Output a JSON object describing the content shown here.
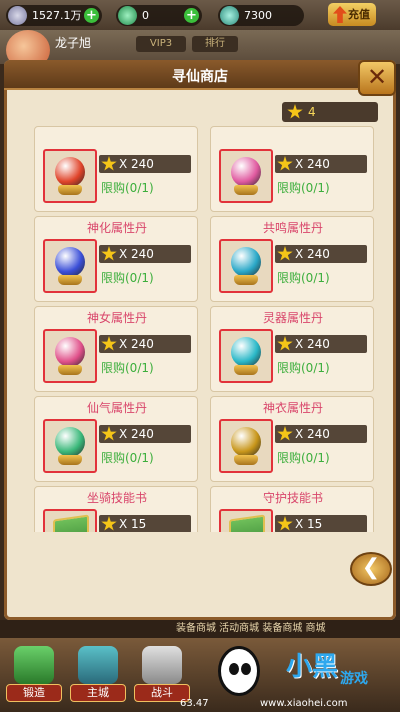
{
  "topbar": {
    "silver": "1527.1万",
    "jade": "0",
    "gold": "7300",
    "recharge_label": "充值"
  },
  "player": {
    "name": "龙子旭",
    "vip": "VIP3",
    "rank": "排行"
  },
  "shop": {
    "title": "寻仙商店",
    "currency": "4",
    "close_symbol": "✕",
    "items": [
      {
        "name": "",
        "price": "X 240",
        "limit": "限购(0/1)",
        "orb_color": "#e0442a"
      },
      {
        "name": "",
        "price": "X 240",
        "limit": "限购(0/1)",
        "orb_color": "#e05aa0"
      },
      {
        "name": "神化属性丹",
        "price": "X 240",
        "limit": "限购(0/1)",
        "orb_color": "#3b4fd8"
      },
      {
        "name": "共鸣属性丹",
        "price": "X 240",
        "limit": "限购(0/1)",
        "orb_color": "#2aa8c8"
      },
      {
        "name": "神女属性丹",
        "price": "X 240",
        "limit": "限购(0/1)",
        "orb_color": "#e0508a"
      },
      {
        "name": "灵器属性丹",
        "price": "X 240",
        "limit": "限购(0/1)",
        "orb_color": "#2ab8c8"
      },
      {
        "name": "仙气属性丹",
        "price": "X 240",
        "limit": "限购(0/1)",
        "orb_color": "#3ab87a"
      },
      {
        "name": "神衣属性丹",
        "price": "X 240",
        "limit": "限购(0/1)",
        "orb_color": "#c8961a"
      },
      {
        "name": "坐骑技能书",
        "price": "X 15",
        "limit": "",
        "orb_color": "#48a848"
      },
      {
        "name": "守护技能书",
        "price": "X 15",
        "limit": "",
        "orb_color": "#48a848"
      }
    ]
  },
  "bottom": {
    "ticker": "装备商城  活动商城  装备商城  商城",
    "dock": [
      {
        "label": "锻造"
      },
      {
        "label": "主城"
      },
      {
        "label": "战斗"
      }
    ],
    "counter": "63.47",
    "logo_text": "小黑",
    "logo_text2": "游戏",
    "logo_url": "www.xiaohei.com"
  },
  "colors": {
    "accent_red": "#e2323a",
    "limit_green": "#3cae3c",
    "name_pink": "#d9466b"
  }
}
